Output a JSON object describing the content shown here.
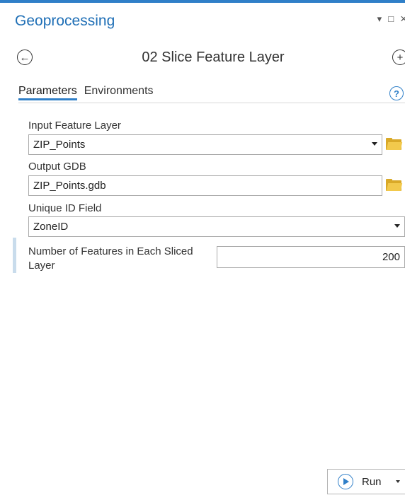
{
  "pane": {
    "title": "Geoprocessing",
    "controls": {
      "pin": "▾",
      "maximize": "□",
      "close": "×"
    }
  },
  "tool": {
    "title": "02 Slice Feature Layer",
    "back_icon": "arrow-left-circle-icon",
    "add_icon": "plus-circle-icon"
  },
  "tabs": {
    "parameters": "Parameters",
    "environments": "Environments",
    "active": "Parameters",
    "help_glyph": "?"
  },
  "params": {
    "input_layer": {
      "label": "Input Feature Layer",
      "value": "ZIP_Points"
    },
    "output_gdb": {
      "label": "Output GDB",
      "value": "ZIP_Points.gdb"
    },
    "unique_id": {
      "label": "Unique ID Field",
      "value": "ZoneID"
    },
    "num_features": {
      "label_line1": "Number of Features in Each Sliced",
      "label_line2": "Layer",
      "value": "200"
    }
  },
  "run": {
    "label": "Run"
  },
  "colors": {
    "accent": "#2f7fc8",
    "folder": "#f2c94c"
  }
}
